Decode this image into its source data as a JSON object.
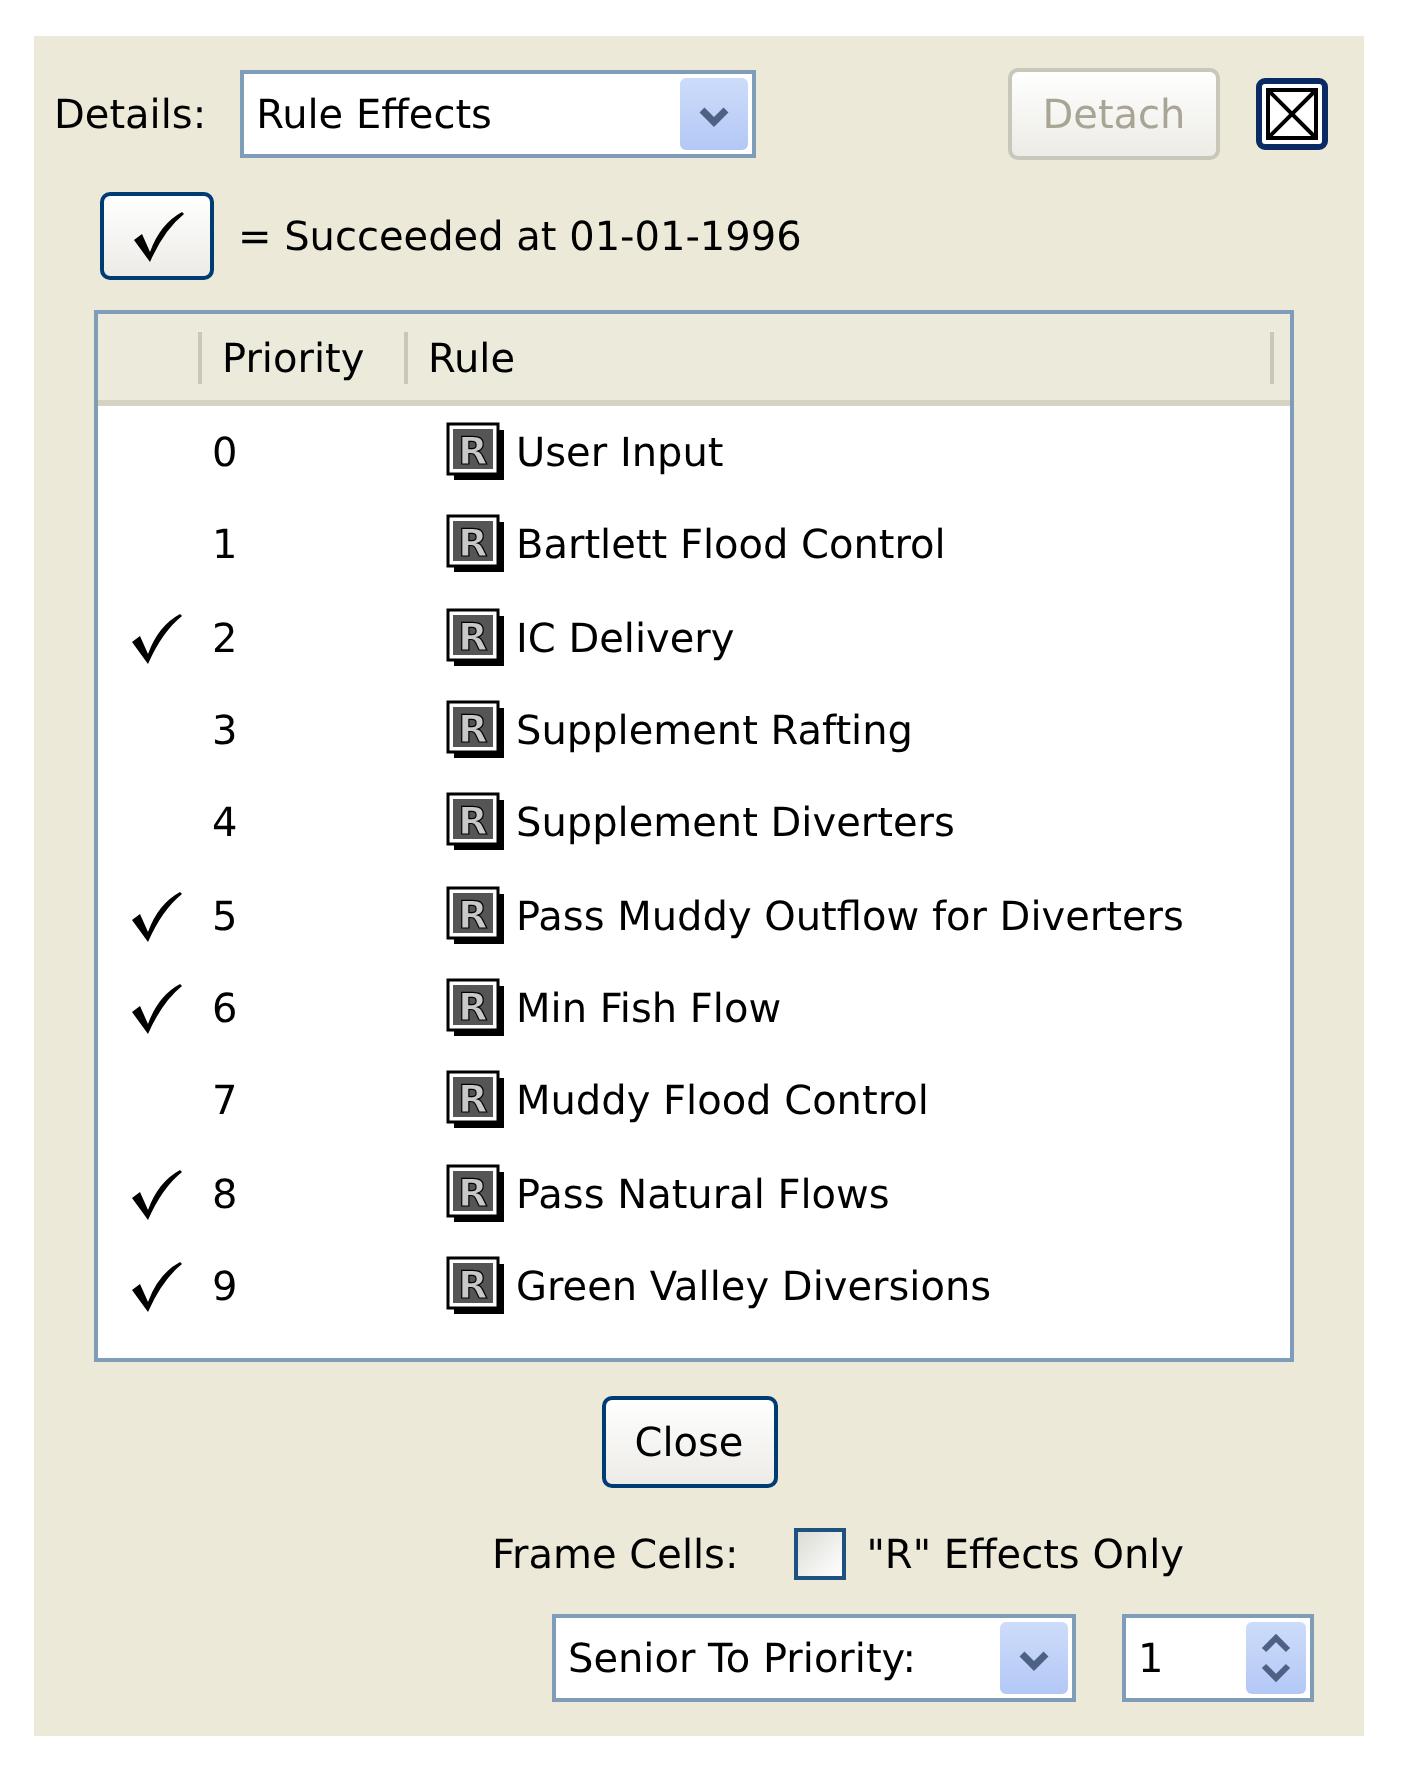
{
  "details": {
    "label": "Details:",
    "value": "Rule Effects"
  },
  "detach_button": {
    "label": "Detach",
    "disabled": true
  },
  "legend": {
    "text": "= Succeeded at 01-01-1996"
  },
  "table": {
    "columns": [
      "Priority",
      "Rule"
    ],
    "rows": [
      {
        "succeeded": false,
        "priority": "0",
        "icon": "R",
        "rule": "User Input"
      },
      {
        "succeeded": false,
        "priority": "1",
        "icon": "R",
        "rule": "Bartlett Flood Control"
      },
      {
        "succeeded": true,
        "priority": "2",
        "icon": "R",
        "rule": "IC Delivery"
      },
      {
        "succeeded": false,
        "priority": "3",
        "icon": "R",
        "rule": "Supplement Rafting"
      },
      {
        "succeeded": false,
        "priority": "4",
        "icon": "R",
        "rule": "Supplement Diverters"
      },
      {
        "succeeded": true,
        "priority": "5",
        "icon": "R",
        "rule": "Pass Muddy Outflow for Diverters"
      },
      {
        "succeeded": true,
        "priority": "6",
        "icon": "R",
        "rule": "Min Fish Flow"
      },
      {
        "succeeded": false,
        "priority": "7",
        "icon": "R",
        "rule": "Muddy Flood Control"
      },
      {
        "succeeded": true,
        "priority": "8",
        "icon": "R",
        "rule": "Pass Natural Flows"
      },
      {
        "succeeded": true,
        "priority": "9",
        "icon": "R",
        "rule": "Green Valley Diversions"
      }
    ]
  },
  "close_button": {
    "label": "Close"
  },
  "frame_cells": {
    "label": "Frame Cells:",
    "checkbox_label": "\"R\" Effects Only",
    "checked": false
  },
  "filter": {
    "value": "Senior To Priority:"
  },
  "priority_spinner": {
    "value": "1"
  }
}
